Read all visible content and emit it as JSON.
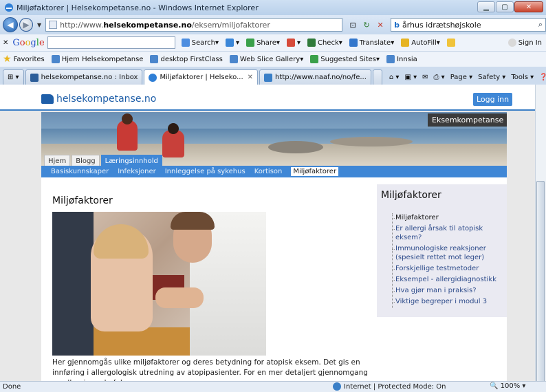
{
  "window": {
    "title": "Miljøfaktorer | Helsekompetanse.no - Windows Internet Explorer",
    "url_prefix": "http://www.",
    "url_domain": "helsekompetanse.no",
    "url_path": "/eksem/miljofaktorer",
    "search_text": "århus idrætshøjskole"
  },
  "google_toolbar": {
    "logo": [
      "G",
      "o",
      "o",
      "g",
      "l",
      "e"
    ],
    "items": [
      "Search",
      "Share",
      "Check",
      "Translate",
      "AutoFill"
    ],
    "signin": "Sign In"
  },
  "favorites": {
    "label": "Favorites",
    "items": [
      "Hjem Helsekompetanse",
      "desktop FirstClass",
      "Web Slice Gallery",
      "Suggested Sites",
      "Innsia"
    ]
  },
  "tabs": [
    {
      "label": "helsekompetanse.no : Inbox",
      "active": false
    },
    {
      "label": "Miljøfaktorer | Helseko...",
      "active": true
    },
    {
      "label": "http://www.naaf.no/no/fe...",
      "active": false
    }
  ],
  "commandbar": [
    "Page",
    "Safety",
    "Tools"
  ],
  "site": {
    "logo_text": "helsekompetanse.no",
    "login": "Logg inn",
    "badge": "Eksemkompetanse",
    "nav": [
      {
        "label": "Hjem",
        "active": false
      },
      {
        "label": "Blogg",
        "active": false
      },
      {
        "label": "Læringsinnhold",
        "active": true
      }
    ],
    "subnav": [
      {
        "label": "Basiskunnskaper",
        "active": false
      },
      {
        "label": "Infeksjoner",
        "active": false
      },
      {
        "label": "Innleggelse på sykehus",
        "active": false
      },
      {
        "label": "Kortison",
        "active": false
      },
      {
        "label": "Miljøfaktorer",
        "active": true
      }
    ],
    "page_title": "Miljøfaktorer",
    "body_text": "Her gjennomgås ulike miljøfaktorer og deres betydning for atopisk eksem. Det gis en innføring i allergologisk utredning av atopipasienter. For en mer detaljert gjennomgang av allergier anbefales",
    "sidebar": {
      "title": "Miljøfaktorer",
      "items": [
        {
          "label": "Miljøfaktorer",
          "current": true
        },
        {
          "label": "Er allergi årsak til atopisk eksem?",
          "current": false
        },
        {
          "label": "Immunologiske reaksjoner (spesielt rettet mot leger)",
          "current": false
        },
        {
          "label": "Forskjellige testmetoder",
          "current": false
        },
        {
          "label": "Eksempel - allergidiagnostikk",
          "current": false
        },
        {
          "label": "Hva gjør man i praksis?",
          "current": false
        },
        {
          "label": "Viktige begreper i modul 3",
          "current": false
        }
      ]
    }
  },
  "status": {
    "left": "Done",
    "zone": "Internet | Protected Mode: On",
    "zoom": "100%"
  }
}
